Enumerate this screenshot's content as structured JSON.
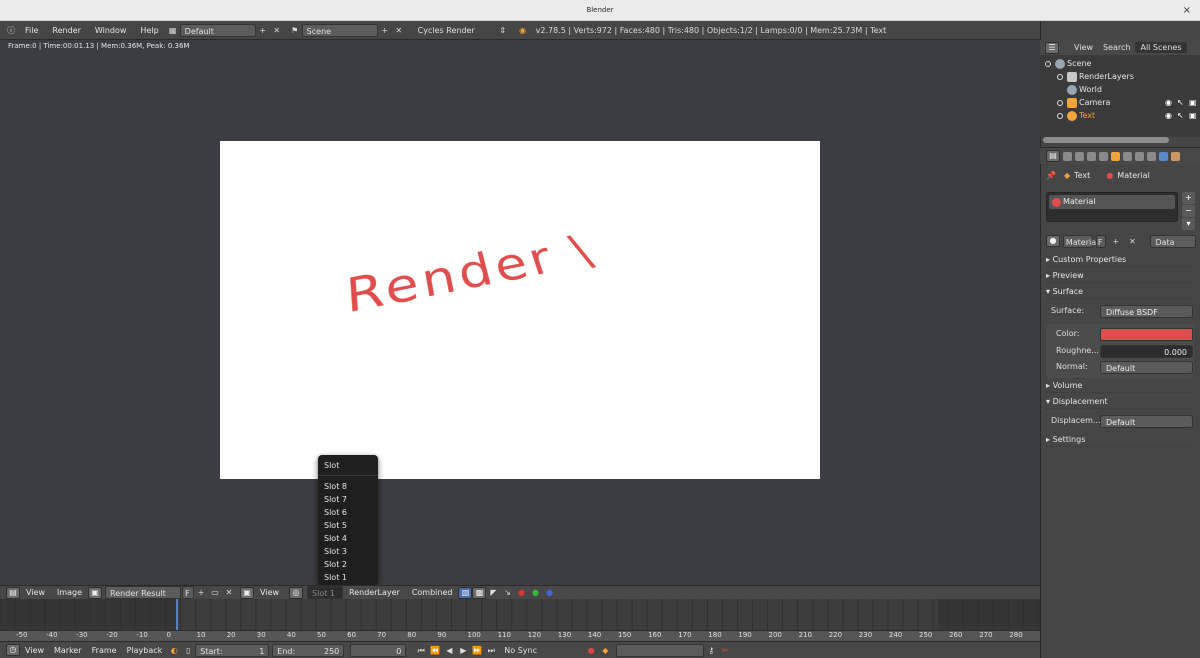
{
  "window": {
    "title": "Blender",
    "close": "×"
  },
  "info_header": {
    "menus": [
      "File",
      "Render",
      "Window",
      "Help"
    ],
    "layout": "Default",
    "scene": "Scene",
    "engine": "Cycles Render",
    "stats": "v2.78.5 | Verts:972 | Faces:480 | Tris:480 | Objects:1/2 | Lamps:0/0 | Mem:25.73M | Text"
  },
  "image_editor": {
    "frame_info": "Frame:0 | Time:00:01.13 | Mem:0.36M, Peak: 0.36M",
    "render_text": "Render \\",
    "header": {
      "view": "View",
      "image": "Image",
      "image_name": "Render Result",
      "fake_user": "F",
      "view2": "View",
      "slot": "Slot 1",
      "render_layer": "RenderLayer",
      "pass": "Combined"
    }
  },
  "slot_menu": {
    "title": "Slot",
    "items": [
      "Slot 8",
      "Slot 7",
      "Slot 6",
      "Slot 5",
      "Slot 4",
      "Slot 3",
      "Slot 2",
      "Slot 1"
    ]
  },
  "timeline": {
    "ruler": [
      "-50",
      "-40",
      "-30",
      "-20",
      "-10",
      "0",
      "10",
      "20",
      "30",
      "40",
      "50",
      "60",
      "70",
      "80",
      "90",
      "100",
      "110",
      "120",
      "130",
      "140",
      "150",
      "160",
      "170",
      "180",
      "190",
      "200",
      "210",
      "220",
      "230",
      "240",
      "250",
      "260",
      "270",
      "280"
    ],
    "menus": [
      "View",
      "Marker",
      "Frame",
      "Playback"
    ],
    "start_label": "Start:",
    "start": "1",
    "end_label": "End:",
    "end": "250",
    "current": "0",
    "sync": "No Sync"
  },
  "outliner": {
    "tabs": [
      "View",
      "Search",
      "All Scenes"
    ],
    "rows": [
      "Scene",
      "RenderLayers",
      "World",
      "Camera",
      "Text"
    ]
  },
  "properties": {
    "context": {
      "object": "Text",
      "material": "Material"
    },
    "material_slot": "Material",
    "datablock": "Material",
    "datablock_fake": "F",
    "link": "Data",
    "panels": {
      "custom_properties": "Custom Properties",
      "preview": "Preview",
      "surface": "Surface",
      "volume": "Volume",
      "displacement": "Displacement",
      "settings": "Settings"
    },
    "surface": {
      "surface_label": "Surface:",
      "surface_value": "Diffuse BSDF",
      "color_label": "Color:",
      "roughness_label": "Roughne...",
      "roughness_value": "0.000",
      "normal_label": "Normal:",
      "normal_value": "Default"
    },
    "displacement": {
      "label": "Displacem...",
      "value": "Default"
    }
  },
  "colors": {
    "accent_red": "#e04d4d",
    "active_orange": "#f2a33a"
  }
}
